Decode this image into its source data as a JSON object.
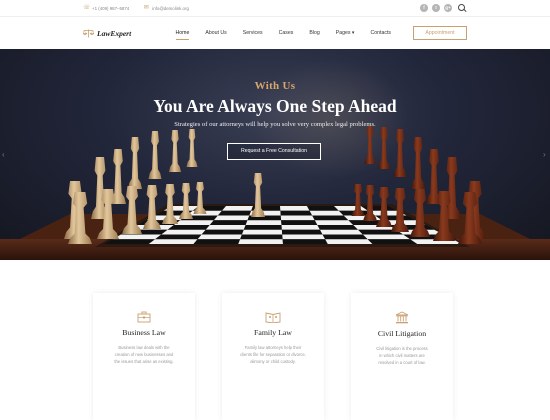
{
  "topbar": {
    "phone": "+1 (409) 987–5874",
    "email": "info@demolink.org",
    "social": [
      "f",
      "t",
      "g+"
    ]
  },
  "nav": {
    "logo": "LawExpert",
    "menu": [
      {
        "label": "Home",
        "active": true
      },
      {
        "label": "About Us"
      },
      {
        "label": "Services"
      },
      {
        "label": "Cases"
      },
      {
        "label": "Blog"
      },
      {
        "label": "Pages ▾"
      },
      {
        "label": "Contacts"
      }
    ],
    "appointment_label": "Appointment"
  },
  "hero": {
    "subtitle": "With Us",
    "title": "You Are Always One Step Ahead",
    "description": "Strategies of our attorneys will help you solve very complex legal problems.",
    "button_label": "Request a Free Consultation"
  },
  "features": [
    {
      "title": "Business Law",
      "icon": "briefcase-icon",
      "text": [
        "Business law deals with the",
        "creation of new businesses and",
        "the issues that arise as existing."
      ]
    },
    {
      "title": "Family Law",
      "icon": "family-book-icon",
      "text": [
        "Family law attorneys help their",
        "clients file for separation or divorce,",
        "alimony or child custody."
      ]
    },
    {
      "title": "Civil Litigation",
      "icon": "courthouse-icon",
      "text": [
        "Civil litigation is the process",
        "in which civil matters are",
        "resolved in a court of law."
      ]
    }
  ],
  "colors": {
    "accent": "#c8a071",
    "hero_bg": "#22263a"
  }
}
